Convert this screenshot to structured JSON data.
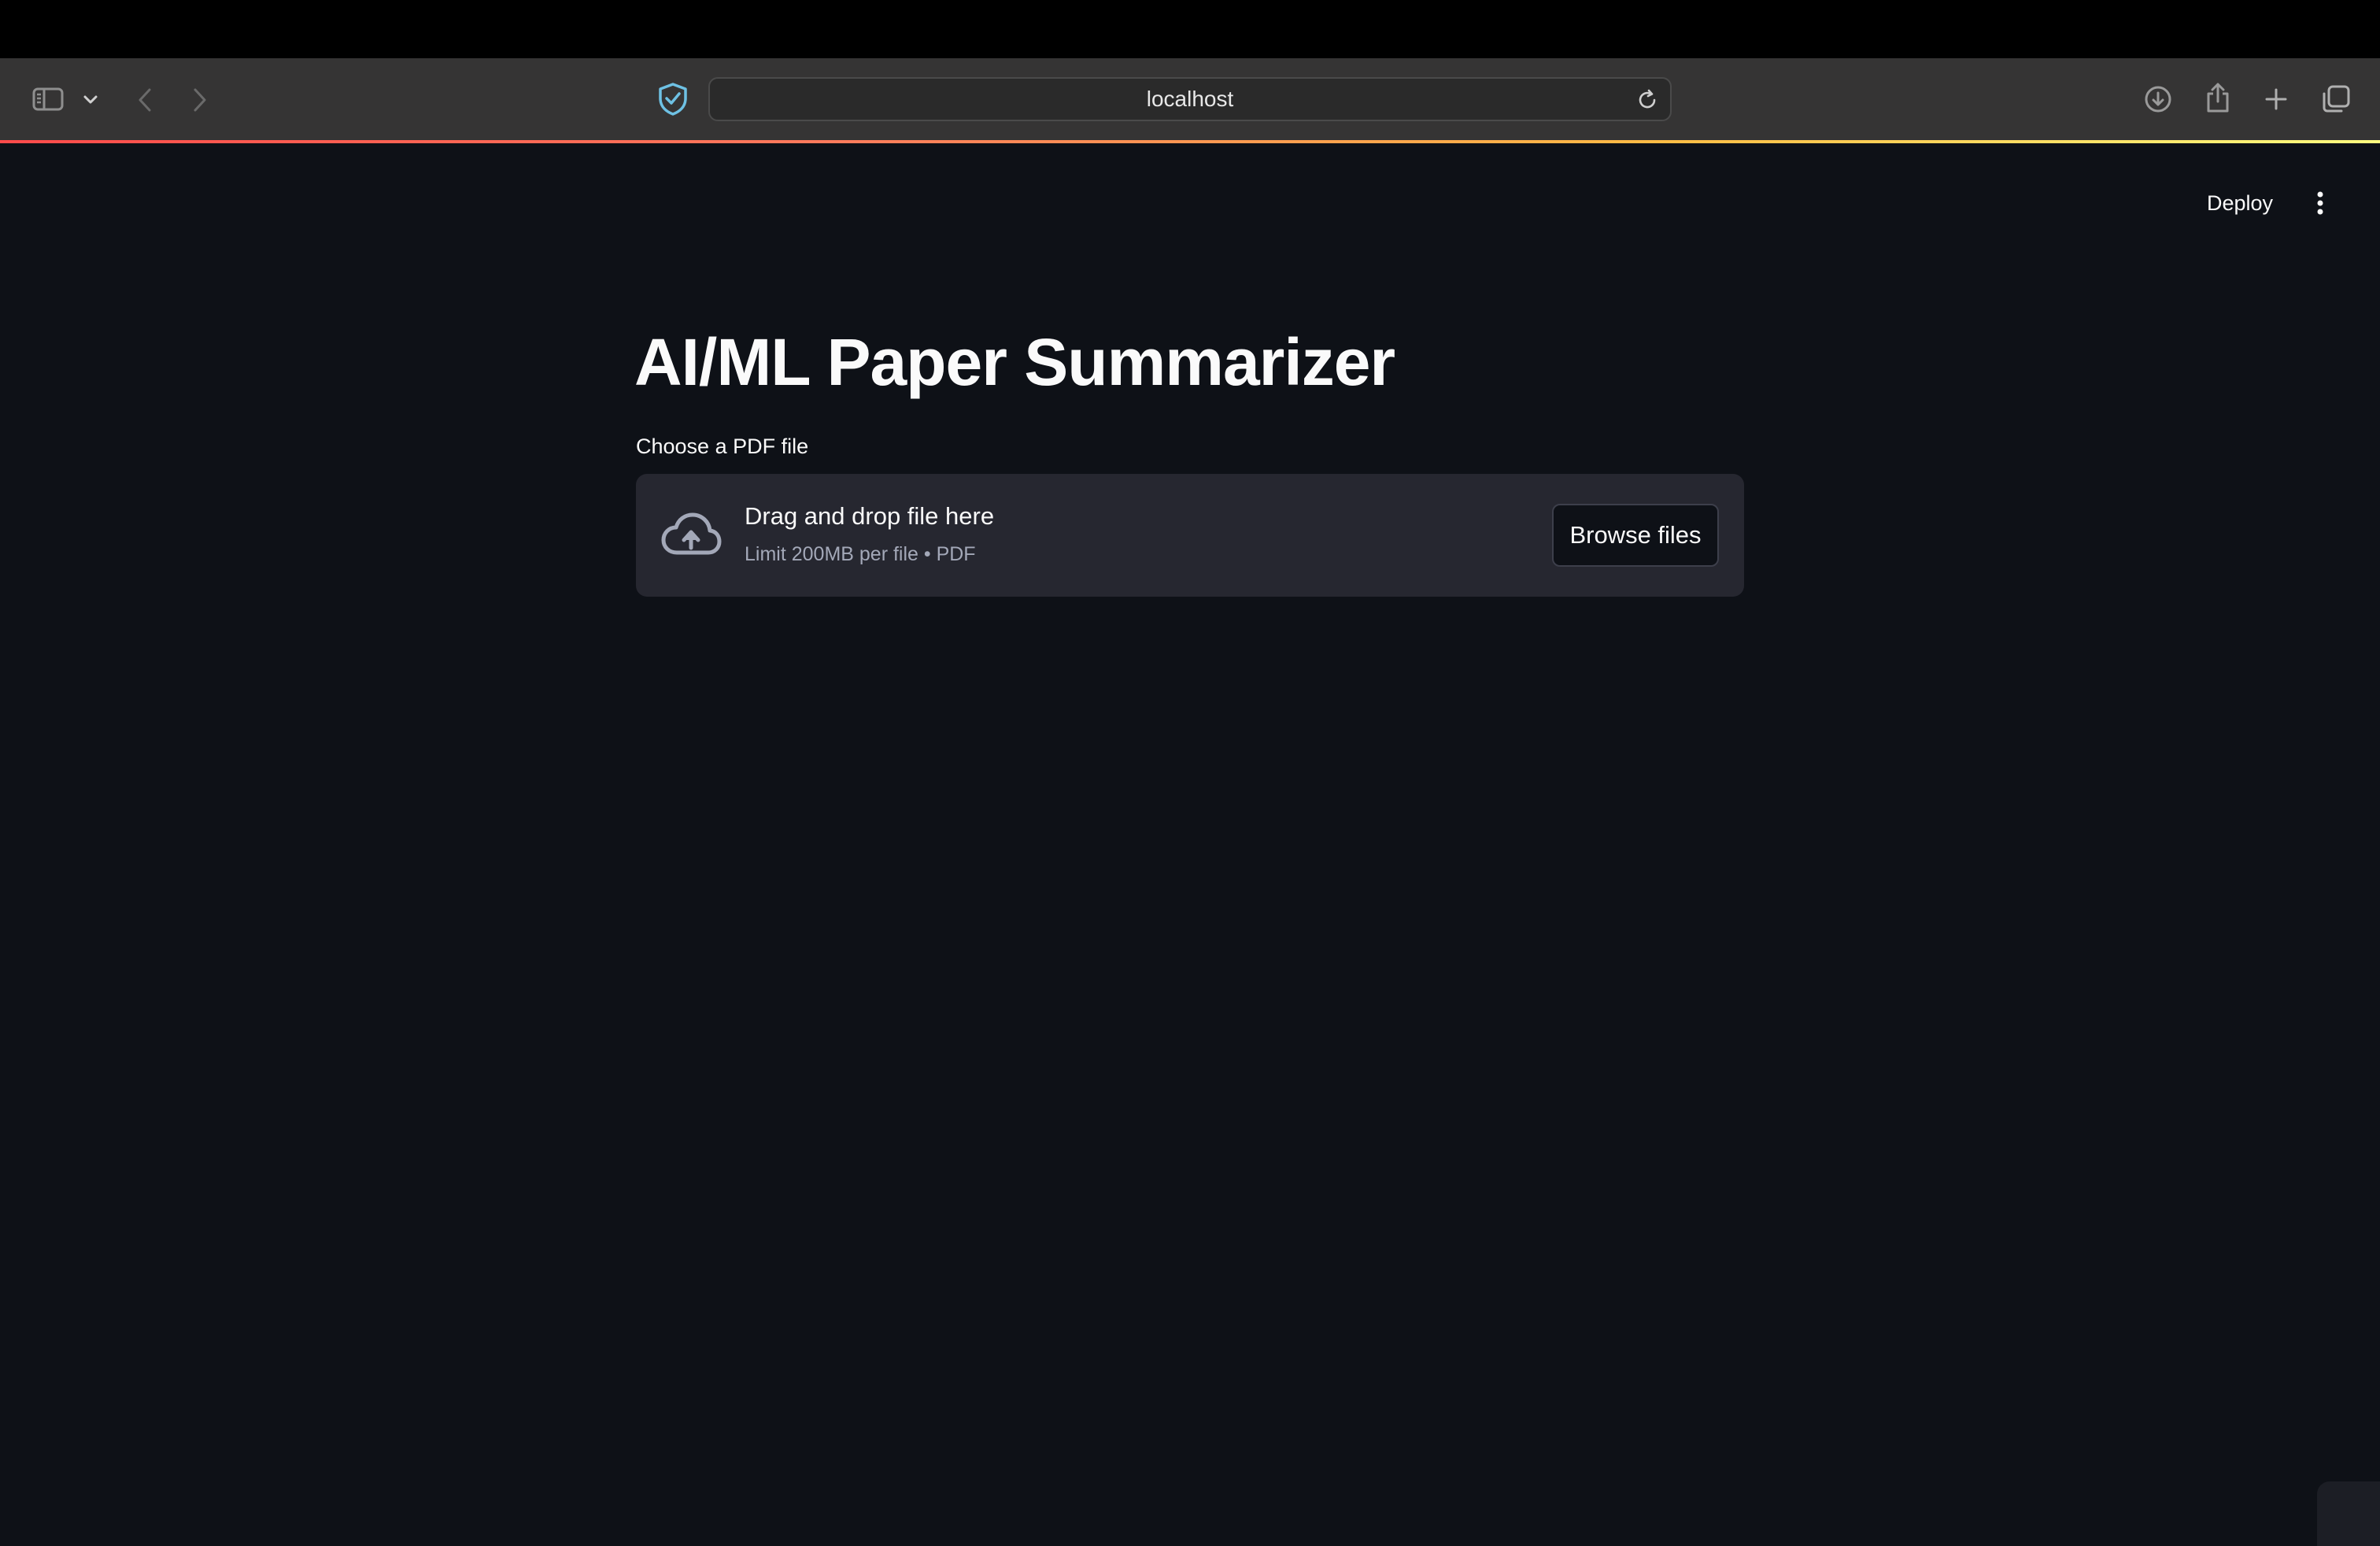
{
  "browser": {
    "url": "localhost",
    "icons": {
      "sidebar": "sidebar-icon",
      "sidebar_menu": "chevron-down-icon",
      "back": "chevron-left-icon",
      "forward": "chevron-right-icon",
      "privacy": "shield-check-icon",
      "reload": "reload-icon",
      "downloads": "download-icon",
      "share": "share-icon",
      "new_tab": "plus-icon",
      "tabs": "tabs-overview-icon"
    }
  },
  "app_header": {
    "deploy_label": "Deploy",
    "menu_icon": "kebab-menu-icon"
  },
  "main": {
    "title": "AI/ML Paper Summarizer",
    "uploader": {
      "label": "Choose a PDF file",
      "drop_text": "Drag and drop file here",
      "limit_text": "Limit 200MB per file • PDF",
      "browse_label": "Browse files",
      "icon": "cloud-upload-icon"
    }
  },
  "colors": {
    "background": "#0e1117",
    "dropzone": "#262730",
    "text": "#fafafa",
    "muted_text": "#a3a8b8",
    "browser_toolbar": "#353434",
    "privacy_icon": "#6ec1e4"
  }
}
